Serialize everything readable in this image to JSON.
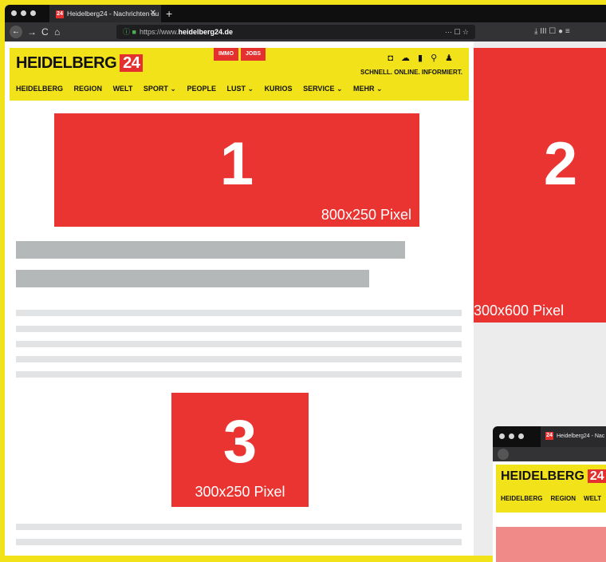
{
  "browser": {
    "tab_title": "Heidelberg24 - Nachrichten au",
    "favicon": "24",
    "tab_close": "✕",
    "new_tab": "+",
    "url_prefix": "https://www.",
    "url_domain": "heidelberg24.de",
    "nav_back": "←",
    "nav_forward": "→",
    "nav_reload": "C",
    "nav_home": "⌂",
    "url_actions": "··· ☐ ☆",
    "toolbar_icons": "⤓ III ☐ ● ≡"
  },
  "site": {
    "logo_text": "HEIDELBERG",
    "logo_num": "24",
    "chip_immo": "IMMO",
    "chip_jobs": "JOBS",
    "slogan": "SCHNELL. ONLINE. INFORMIERT.",
    "nav": [
      "HEIDELBERG",
      "REGION",
      "WELT",
      "SPORT ⌄",
      "PEOPLE",
      "LUST ⌄",
      "KURIOS",
      "SERVICE ⌄",
      "MEHR ⌄"
    ],
    "icons": [
      "camera-icon",
      "weather-icon",
      "bookmark-icon",
      "search-icon",
      "user-icon"
    ]
  },
  "ads": {
    "a1": {
      "num": "1",
      "size": "800x250 Pixel"
    },
    "a2": {
      "num": "2",
      "size": "300x600 Pixel"
    },
    "a3": {
      "num": "3",
      "size": "300x250 Pixel"
    }
  },
  "mini": {
    "tab_title": "Heidelberg24 - Nac",
    "logo_text": "HEIDELBERG",
    "logo_num": "24",
    "nav": [
      "HEIDELBERG",
      "REGION",
      "WELT"
    ]
  },
  "colors": {
    "brand_yellow": "#f2e21a",
    "ad_red": "#ea3431",
    "placeholder_gray": "#b5b8b9"
  }
}
